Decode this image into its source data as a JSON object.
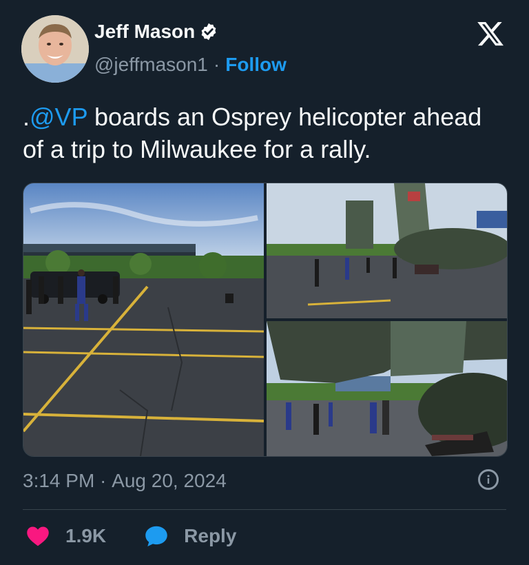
{
  "author": {
    "name": "Jeff Mason",
    "handle": "@jeffmason1",
    "separator": "·",
    "follow_label": "Follow",
    "verified": true
  },
  "tweet": {
    "prefix": ".",
    "mention": "@VP",
    "body": " boards an Osprey helicopter ahead of a trip to Milwaukee for a rally."
  },
  "media": [
    {
      "alt": "Photo of people walking across a parking lot toward a vehicle"
    },
    {
      "alt": "Photo of people walking toward an Osprey aircraft on a tarmac"
    },
    {
      "alt": "Photo of people boarding an Osprey aircraft"
    }
  ],
  "meta": {
    "time": "3:14 PM",
    "separator": " · ",
    "date": "Aug 20, 2024"
  },
  "actions": {
    "like_count": "1.9K",
    "reply_label": "Reply"
  },
  "colors": {
    "background": "#15202b",
    "accent": "#1d9bf0",
    "like": "#f91880",
    "muted": "#8b98a5"
  },
  "icons": [
    "verified-icon",
    "x-logo-icon",
    "info-icon",
    "heart-icon",
    "reply-icon"
  ]
}
